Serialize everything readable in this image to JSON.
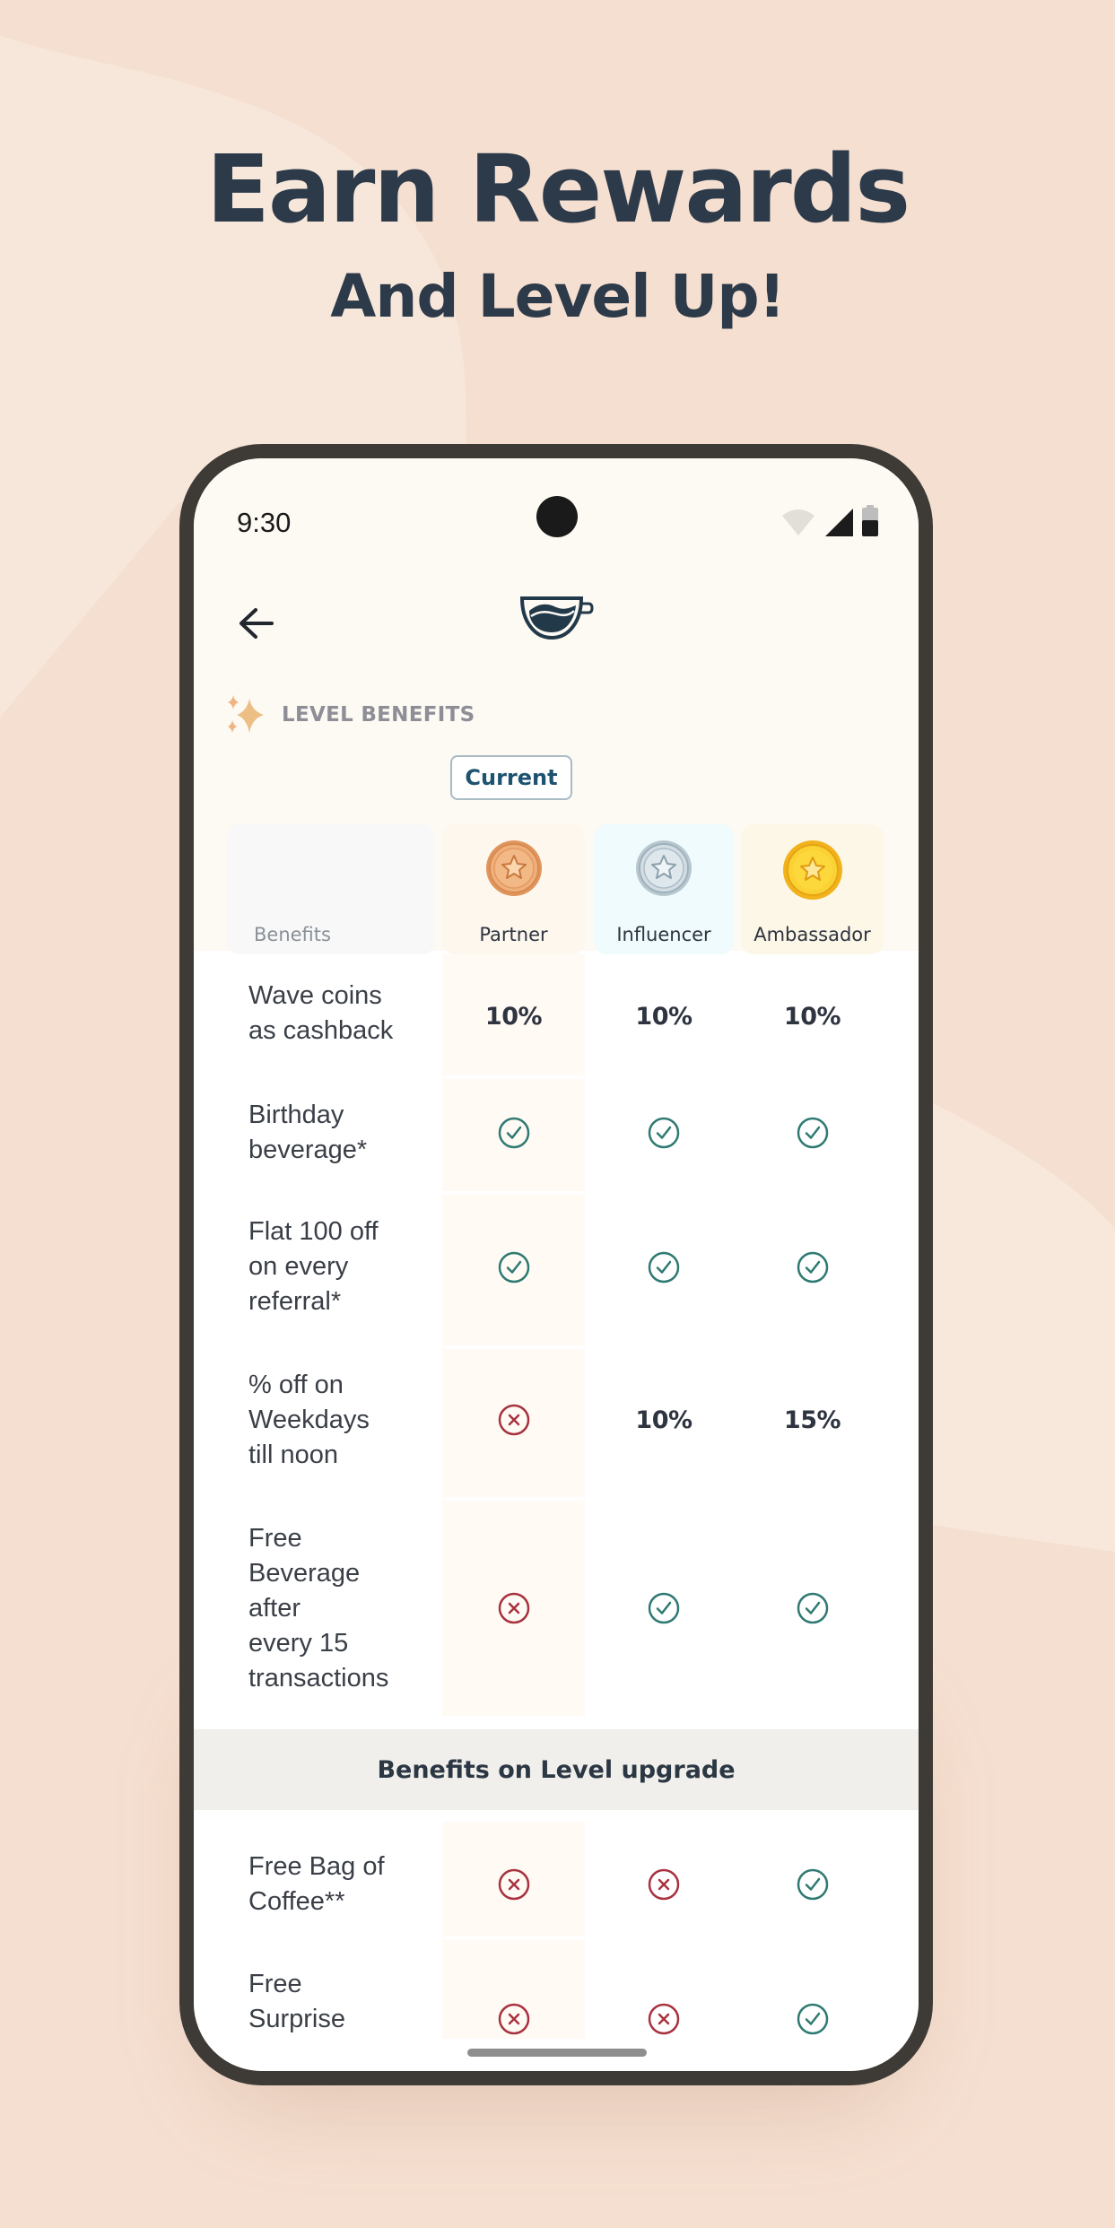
{
  "headline": {
    "title": "Earn Rewards",
    "subtitle": "And Level Up!"
  },
  "status_bar": {
    "time": "9:30",
    "icons": [
      "wifi-icon",
      "signal-icon",
      "battery-icon"
    ]
  },
  "nav": {
    "back_icon": "arrow-left-icon",
    "logo": "coffee-cup-wave-logo"
  },
  "section": {
    "icon": "sparkles-icon",
    "title": "LEVEL BENEFITS"
  },
  "current_badge": "Current",
  "columns": {
    "benefits": "Benefits",
    "tiers": [
      {
        "name": "Partner",
        "medal": "bronze-medal-icon",
        "current": true
      },
      {
        "name": "Influencer",
        "medal": "silver-medal-icon",
        "current": false
      },
      {
        "name": "Ambassador",
        "medal": "gold-medal-icon",
        "current": false
      }
    ]
  },
  "rows": [
    {
      "label": "Wave coins\nas cashback",
      "values": [
        "10%",
        "10%",
        "10%"
      ]
    },
    {
      "label": "Birthday\nbeverage*",
      "values": [
        "check",
        "check",
        "check"
      ]
    },
    {
      "label": "Flat 100 off\non every\nreferral*",
      "values": [
        "check",
        "check",
        "check"
      ]
    },
    {
      "label": "% off on\nWeekdays\ntill noon",
      "values": [
        "cross",
        "10%",
        "15%"
      ]
    },
    {
      "label": "Free\nBeverage\nafter\nevery 15\ntransactions",
      "values": [
        "cross",
        "check",
        "check"
      ]
    }
  ],
  "upgrade_section": {
    "title": "Benefits on Level upgrade",
    "rows": [
      {
        "label": "Free Bag of\nCoffee**",
        "values": [
          "cross",
          "cross",
          "check"
        ]
      },
      {
        "label": "Free\nSurprise",
        "values": [
          "cross",
          "cross",
          "check"
        ]
      }
    ]
  },
  "colors": {
    "check": "#2f7a72",
    "cross": "#a8323f",
    "heading": "#2c3a4a",
    "badge_text": "#1d5270"
  }
}
